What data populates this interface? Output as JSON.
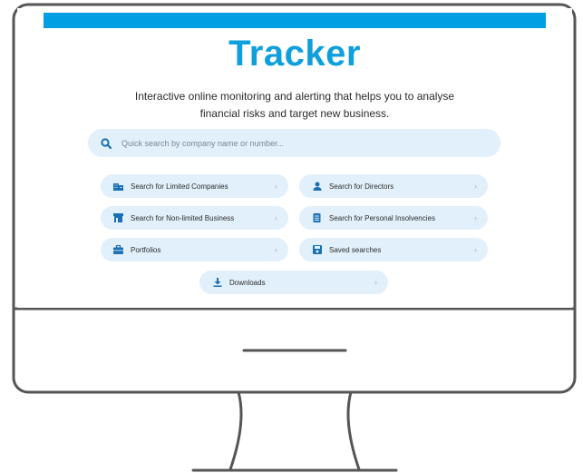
{
  "app": {
    "title": "Tracker",
    "subtitle": "Interactive online monitoring and alerting that helps you to analyse financial risks and target new business."
  },
  "search": {
    "placeholder": "Quick search by company name or number...",
    "value": ""
  },
  "buttons": [
    {
      "label": "Search for Limited Companies",
      "icon": "building-icon"
    },
    {
      "label": "Search for Directors",
      "icon": "person-icon"
    },
    {
      "label": "Search for Non-limited Business",
      "icon": "shop-icon"
    },
    {
      "label": "Search for Personal Insolvencies",
      "icon": "document-icon"
    },
    {
      "label": "Portfolios",
      "icon": "briefcase-icon"
    },
    {
      "label": "Saved searches",
      "icon": "save-icon"
    },
    {
      "label": "Downloads",
      "icon": "download-icon"
    }
  ],
  "colors": {
    "accent": "#009fe3",
    "title": "#0ea0dc",
    "button_bg": "#e2f0fb",
    "icon": "#1a6fb5",
    "monitor_stroke": "#555555"
  }
}
